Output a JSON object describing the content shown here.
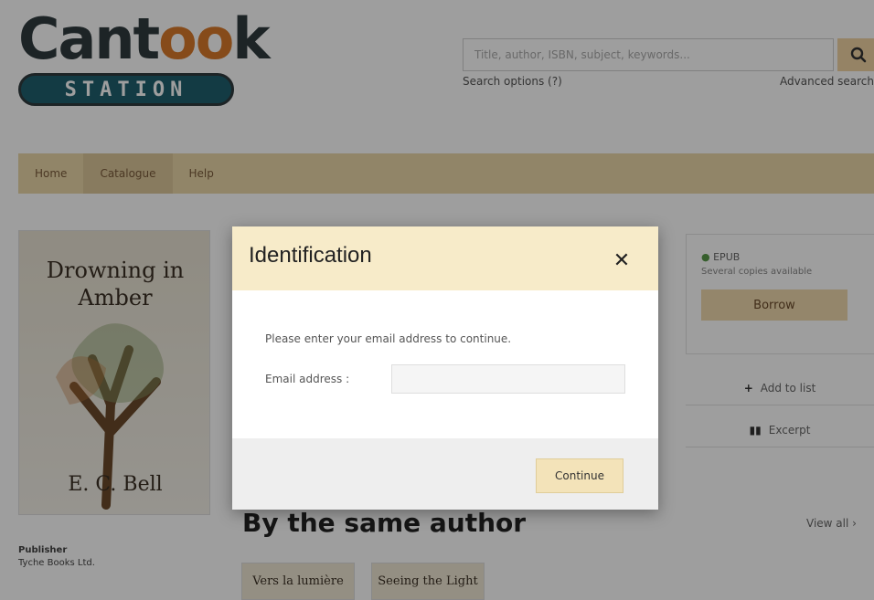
{
  "logo": {
    "word_prefix": "Cant",
    "word_oo": "oo",
    "word_suffix": "k",
    "station": "STATION"
  },
  "search": {
    "placeholder": "Title, author, ISBN, subject, keywords...",
    "options_link": "Search options (?)",
    "advanced_link": "Advanced search"
  },
  "nav": {
    "items": [
      {
        "label": "Home"
      },
      {
        "label": "Catalogue"
      },
      {
        "label": "Help"
      }
    ]
  },
  "book": {
    "cover_title": "Drowning in Amber",
    "cover_author": "E. C. Bell",
    "publisher_label": "Publisher",
    "publisher_value": "Tyche Books Ltd."
  },
  "availability": {
    "format": "EPUB",
    "status": "Several copies available",
    "borrow_label": "Borrow",
    "add_to_list_label": "Add to list",
    "excerpt_label": "Excerpt"
  },
  "same_author": {
    "heading": "By the same author",
    "view_all": "View all",
    "thumbs": [
      {
        "title": "Vers la lumière"
      },
      {
        "title": "Seeing the Light"
      }
    ]
  },
  "modal": {
    "title": "Identification",
    "close_symbol": "✕",
    "message": "Please enter your email address to continue.",
    "email_label": "Email address :",
    "email_value": "",
    "continue_label": "Continue"
  },
  "colors": {
    "accent": "#ead7a9",
    "modal_header": "#f7ebc9",
    "button": "#f3e3b9",
    "logo_orange": "#d9792b"
  }
}
